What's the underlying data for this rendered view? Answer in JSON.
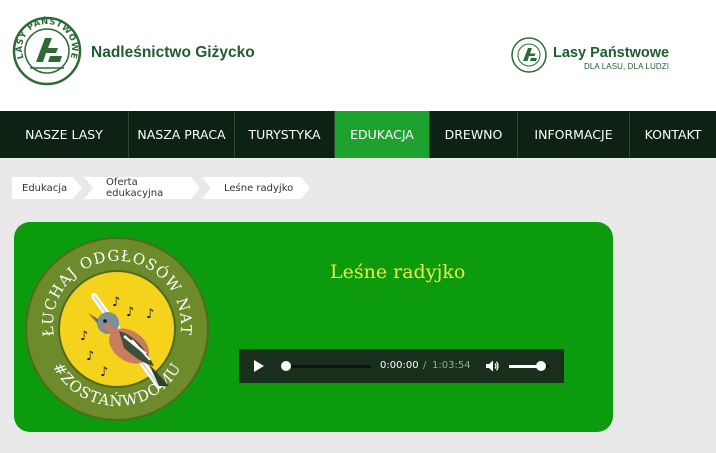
{
  "header": {
    "site_title": "Nadleśnictwo Giżycko",
    "logo_ring_text": "LASY PAŃSTWOWE",
    "brand_name": "Lasy Państwowe",
    "brand_slogan": "DLA LASU, DLA LUDZI"
  },
  "nav": {
    "items": [
      "NASZE LASY",
      "NASZA PRACA",
      "TURYSTYKA",
      "EDUKACJA",
      "DREWNO",
      "INFORMACJE",
      "KONTAKT"
    ],
    "active": "EDUKACJA"
  },
  "breadcrumb": [
    "Edukacja",
    "Oferta edukacyjna",
    "Leśne radyjko"
  ],
  "card": {
    "title": "Leśne radyjko",
    "badge_top_text": "POSŁUCHAJ ODGŁOSÓW NATURY",
    "badge_bottom_text": "#ZOSTAŃWDOMU"
  },
  "player": {
    "time_current": "0:00:00",
    "separator": "/",
    "time_total": "1:03:54",
    "progress": 0,
    "volume": 0.8
  },
  "colors": {
    "brand_green": "#1e5e2c",
    "nav_bg": "#0e2213",
    "nav_active": "#1ea22f",
    "card_bg": "#0c9b0c",
    "title_yellow": "#f4e84a"
  },
  "icons": {
    "logo": "lasy-panstwowe-logo-icon",
    "play": "play-icon",
    "volume": "volume-icon"
  }
}
